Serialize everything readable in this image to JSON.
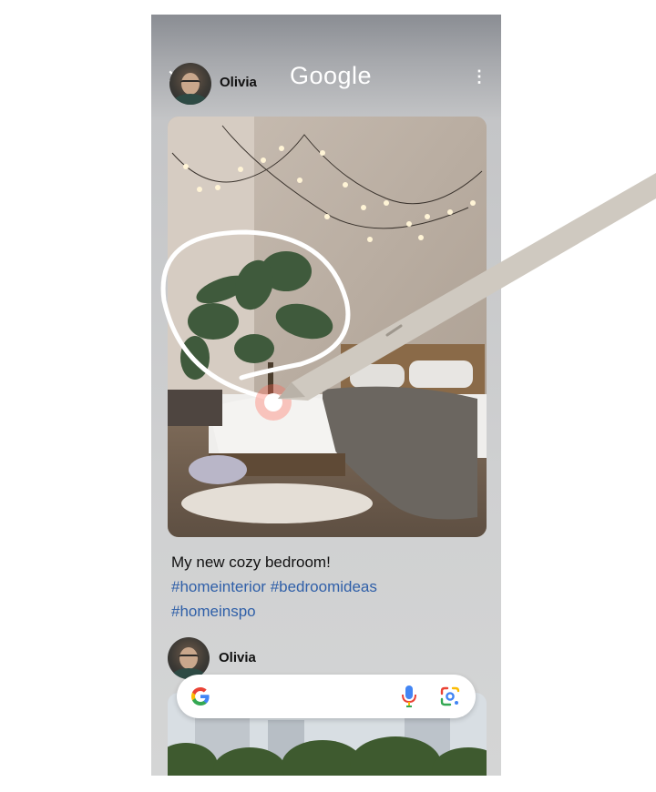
{
  "header": {
    "close_icon": "close-icon",
    "user_name": "Olivia",
    "brand": "Google",
    "more_icon": "more-vert-icon"
  },
  "post": {
    "caption": "My new cozy bedroom!",
    "hashtags": [
      "#homeinterior",
      "#bedroomideas",
      "#homeinspo"
    ]
  },
  "next_post": {
    "user_name": "Olivia"
  },
  "search_bar": {
    "logo": "google-g-logo",
    "mic_icon": "microphone-icon",
    "lens_icon": "google-lens-icon"
  },
  "colors": {
    "hashtag": "#2f5fa8",
    "brand_text": "#ffffff",
    "google_blue": "#4285F4",
    "google_red": "#EA4335",
    "google_yellow": "#FBBC05",
    "google_green": "#34A853"
  }
}
